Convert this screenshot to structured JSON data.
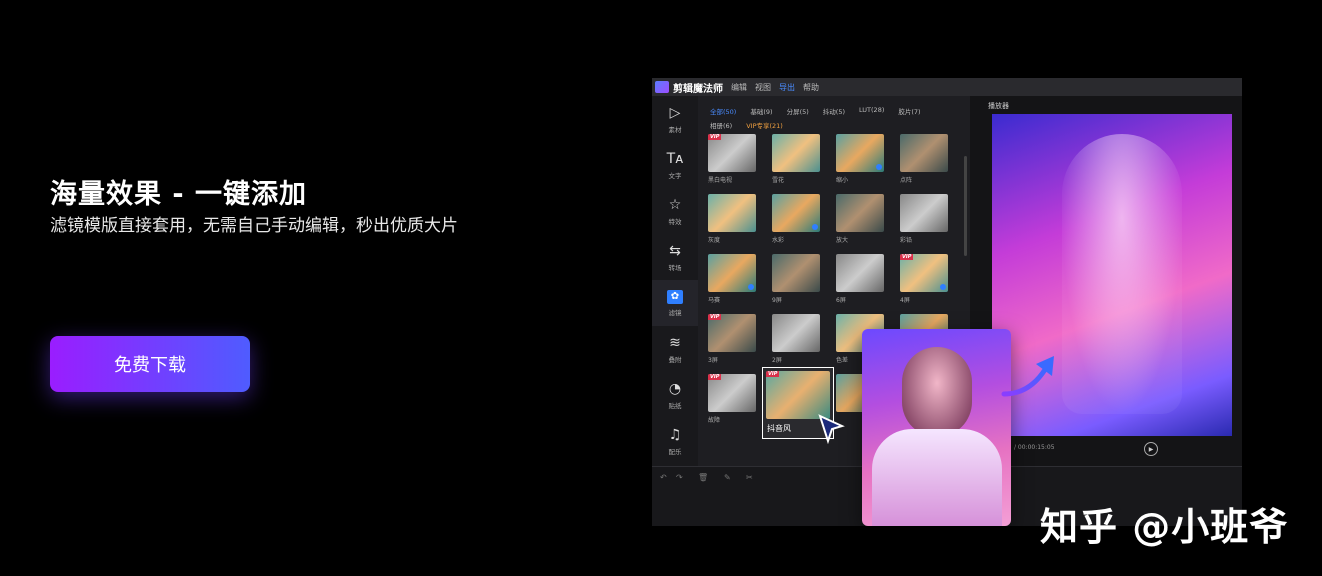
{
  "hero": {
    "title": "海量效果 - 一键添加",
    "subtitle": "滤镜模版直接套用，无需自己手动编辑，秒出优质大片",
    "download_label": "免费下载"
  },
  "app": {
    "name": "剪辑魔法师",
    "menu": [
      "编辑",
      "视图",
      "导出",
      "帮助"
    ],
    "active_menu": "导出",
    "sidebar": [
      {
        "label": "素材",
        "icon": "media-icon"
      },
      {
        "label": "文字",
        "icon": "text-icon"
      },
      {
        "label": "特效",
        "icon": "effects-icon"
      },
      {
        "label": "转场",
        "icon": "transition-icon"
      },
      {
        "label": "滤镜",
        "icon": "filter-icon"
      },
      {
        "label": "叠附",
        "icon": "overlay-icon"
      },
      {
        "label": "贴纸",
        "icon": "sticker-icon"
      },
      {
        "label": "配乐",
        "icon": "music-icon"
      }
    ],
    "active_sidebar": "滤镜",
    "filter_tabs": [
      "全部(50)",
      "基础(9)",
      "分屏(5)",
      "抖动(5)",
      "LUT(28)",
      "胶片(7)",
      "相册(6)",
      "VIP专享(21)"
    ],
    "filters": [
      {
        "label": "黑白电视",
        "vip": true
      },
      {
        "label": "雪花",
        "vip": false
      },
      {
        "label": "缩小",
        "vip": false
      },
      {
        "label": "点阵",
        "vip": false
      },
      {
        "label": "灰度",
        "vip": false
      },
      {
        "label": "水彩",
        "vip": false
      },
      {
        "label": "放大",
        "vip": false
      },
      {
        "label": "彩铅",
        "vip": false
      },
      {
        "label": "马赛",
        "vip": false
      },
      {
        "label": "9屏",
        "vip": false
      },
      {
        "label": "6屏",
        "vip": false
      },
      {
        "label": "4屏",
        "vip": true
      },
      {
        "label": "3屏",
        "vip": true
      },
      {
        "label": "2屏",
        "vip": false
      },
      {
        "label": "色差",
        "vip": false
      },
      {
        "label": "",
        "vip": false
      },
      {
        "label": "故障",
        "vip": true
      },
      {
        "label": "",
        "vip": false
      },
      {
        "label": "",
        "vip": false
      },
      {
        "label": "",
        "vip": false
      }
    ],
    "dragging_filter": "抖音风",
    "player_label": "播放器",
    "time": "/ 00:00:15:05"
  },
  "watermark": "知乎 @小班爷",
  "colors": {
    "accent": "#4a8cff",
    "button_start": "#9a1dff",
    "button_end": "#4f5cff",
    "vip": "#d9304a"
  }
}
